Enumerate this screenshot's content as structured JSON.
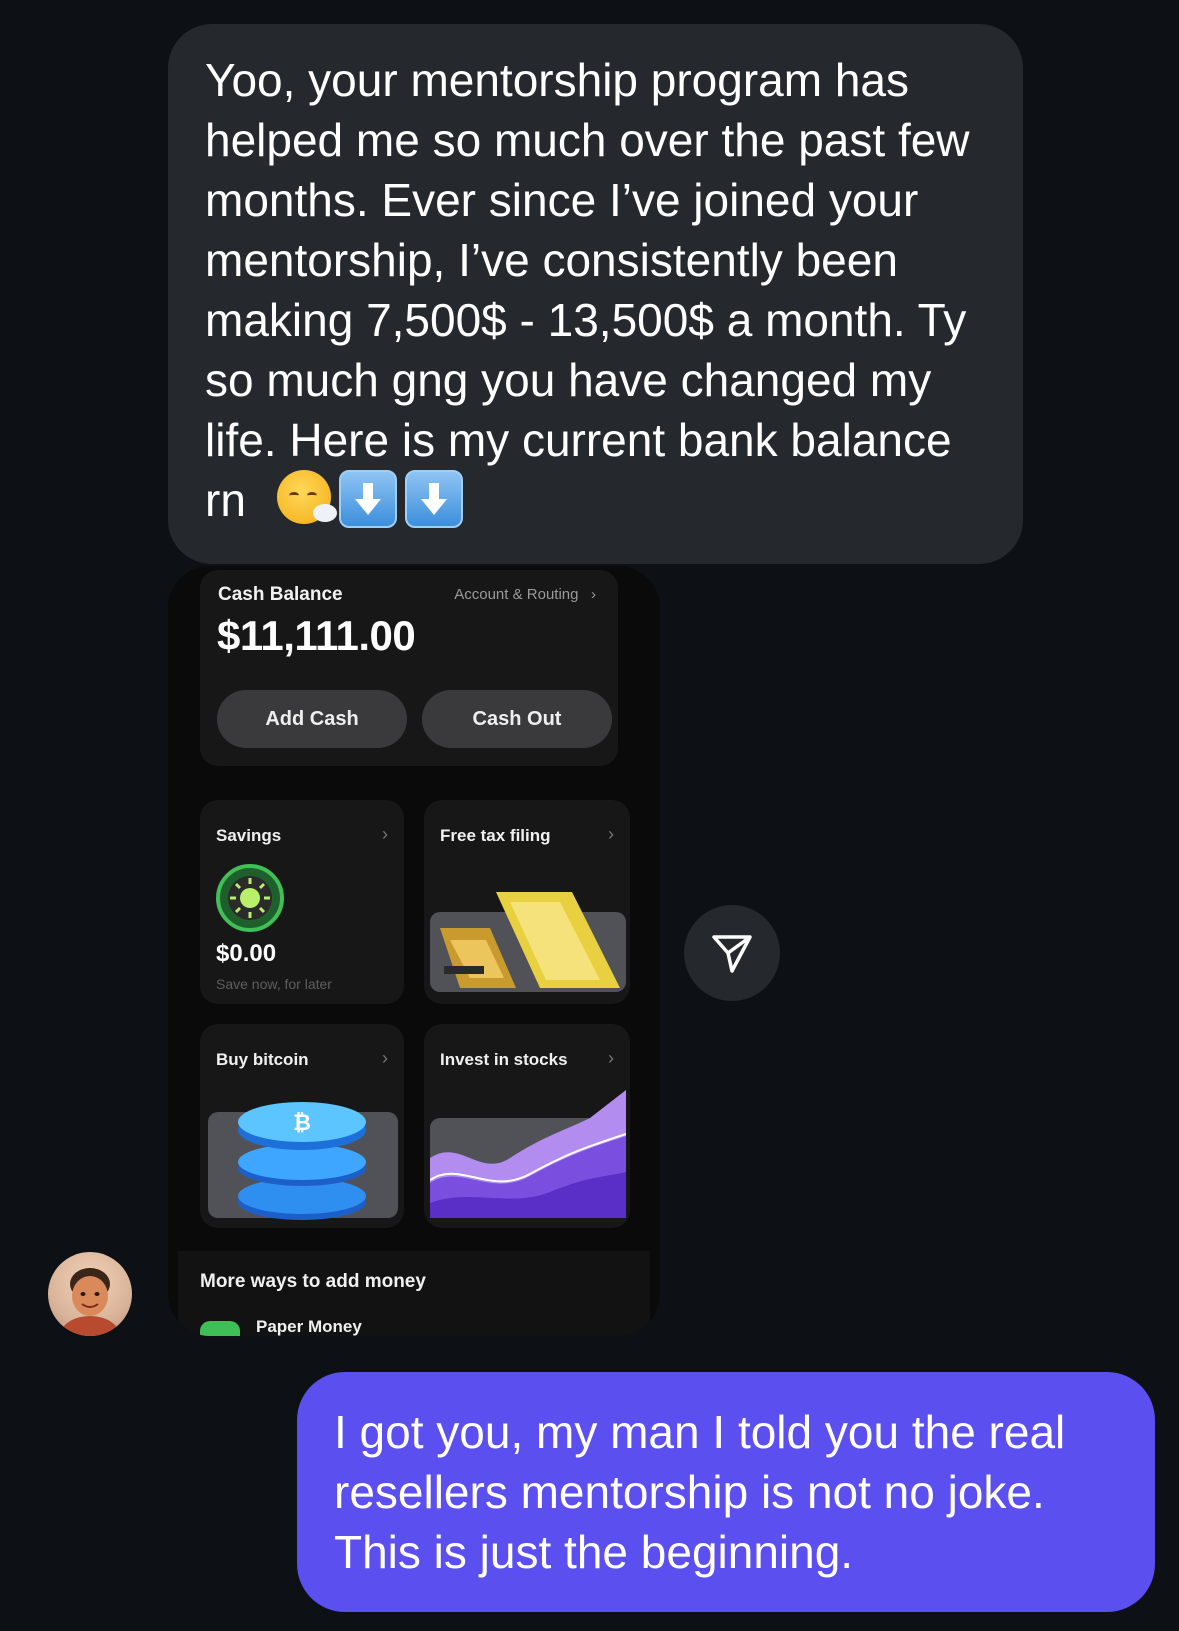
{
  "conversation": {
    "incoming_message": {
      "text": "Yoo, your mentorship program has helped me so much over the past few months. Ever since I’ve joined your mentorship, I’ve consistently been making 7,500$ - 13,500$ a month. Ty so much gng you have changed my life. Here is my current bank balance rn",
      "emojis": [
        "face-exhaling-emoji",
        "down-arrow-emoji",
        "down-arrow-emoji"
      ]
    },
    "attachment": {
      "cash_balance_label": "Cash Balance",
      "account_routing_label": "Account & Routing",
      "balance": "$11,111.00",
      "add_cash_label": "Add Cash",
      "cash_out_label": "Cash Out",
      "tiles": {
        "savings": {
          "title": "Savings",
          "amount": "$0.00",
          "subtitle": "Save now, for later"
        },
        "tax": {
          "title": "Free tax filing"
        },
        "bitcoin": {
          "title": "Buy bitcoin"
        },
        "stocks": {
          "title": "Invest in stocks"
        }
      },
      "more_ways_label": "More ways to add money",
      "paper_money_label": "Paper Money"
    },
    "outgoing_message": {
      "text": "I got you, my man I told you the real resellers mentorship is not no joke. This is just the beginning."
    }
  },
  "colors": {
    "background": "#0d1014",
    "incoming_bubble": "#25282d",
    "outgoing_bubble": "#5b4ff0"
  },
  "icons": {
    "share": "paper-plane-icon",
    "avatar": "avatar"
  }
}
